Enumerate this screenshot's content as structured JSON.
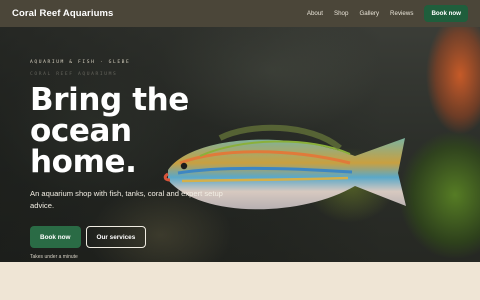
{
  "nav": {
    "brand": "Coral Reef Aquariums",
    "links": [
      "About",
      "Shop",
      "Gallery",
      "Reviews"
    ],
    "cta": "Book now"
  },
  "hero": {
    "eyebrow": "AQUARIUM & FISH · GLEBE",
    "eyebrow_ghost": "CORAL REEF AQUARIUMS",
    "headline_line1": "Bring the ocean",
    "headline_line2": "home.",
    "subtitle": "An aquarium shop with fish, tanks, coral and expert setup advice.",
    "primary_button": "Book now",
    "secondary_button": "Our services",
    "note": "Takes under a minute"
  },
  "colors": {
    "nav_bg": "#4b4639",
    "accent_green": "#2a6b45",
    "lower_bg": "#efe5d5"
  }
}
